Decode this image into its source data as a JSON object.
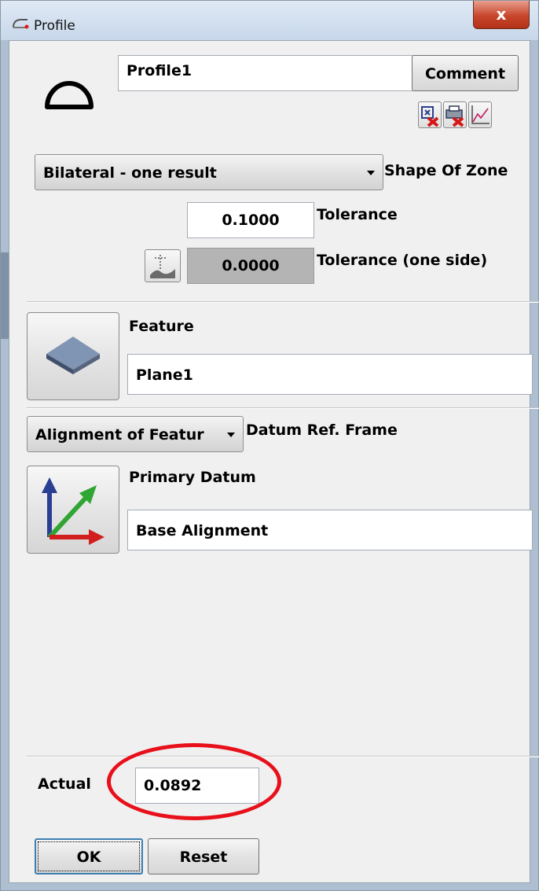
{
  "window": {
    "title": "Profile",
    "close_symbol": "x"
  },
  "header": {
    "name_value": "Profile1",
    "comment_label": "Comment",
    "toolbar_icons": [
      "delete-dimension-icon",
      "delete-print-icon",
      "graph-icon"
    ]
  },
  "zone": {
    "shape_selected": "Bilateral - one result",
    "shape_label": "Shape Of Zone",
    "tolerance_value": "0.1000",
    "tolerance_label": "Tolerance",
    "one_side_value": "0.0000",
    "one_side_label": "Tolerance (one side)"
  },
  "feature": {
    "label": "Feature",
    "value": "Plane1"
  },
  "datum": {
    "frame_selected": "Alignment of Featur",
    "frame_label": "Datum Ref. Frame",
    "primary_label": "Primary Datum",
    "primary_value": "Base Alignment"
  },
  "actual": {
    "label": "Actual",
    "value": "0.0892",
    "highlight_color": "#e8101a"
  },
  "footer": {
    "ok_label": "OK",
    "reset_label": "Reset"
  }
}
